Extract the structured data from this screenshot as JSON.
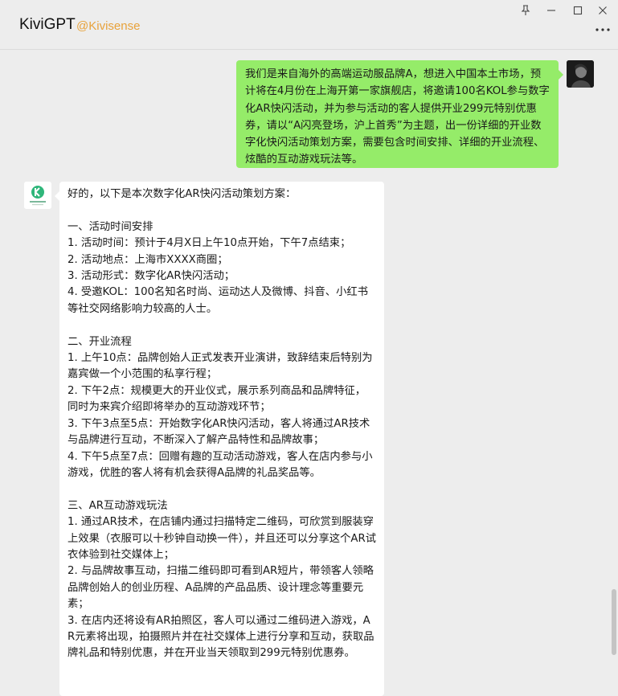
{
  "header": {
    "title": "KiviGPT",
    "handle": "@Kivisense"
  },
  "window_controls": {
    "pin_icon": "pin-icon",
    "minimize_icon": "minimize-icon",
    "maximize_icon": "maximize-icon",
    "close_icon": "close-icon",
    "more_icon": "more-icon"
  },
  "messages": {
    "user": {
      "text": "我们是来自海外的高端运动服品牌A，想进入中国本土市场，预计将在4月份在上海开第一家旗舰店，将邀请100名KOL参与数字化AR快闪活动，并为参与活动的客人提供开业299元特别优惠券，请以“A闪亮登场，沪上首秀”为主题，出一份详细的开业数字化快闪活动策划方案，需要包含时间安排、详细的开业流程、炫酷的互动游戏玩法等。"
    },
    "bot": {
      "text": "好的，以下是本次数字化AR快闪活动策划方案：\n\n一、活动时间安排\n1. 活动时间：预计于4月X日上午10点开始，下午7点结束；\n2. 活动地点：上海市XXXX商圈；\n3. 活动形式：数字化AR快闪活动；\n4. 受邀KOL：100名知名时尚、运动达人及微博、抖音、小红书等社交网络影响力较高的人士。\n\n二、开业流程\n1. 上午10点：品牌创始人正式发表开业演讲，致辞结束后特别为嘉宾做一个小范围的私享行程；\n2. 下午2点：规模更大的开业仪式，展示系列商品和品牌特征，同时为来宾介绍即将举办的互动游戏环节；\n3. 下午3点至5点：开始数字化AR快闪活动，客人将通过AR技术与品牌进行互动，不断深入了解产品特性和品牌故事；\n4. 下午5点至7点：回赠有趣的互动活动游戏，客人在店内参与小游戏，优胜的客人将有机会获得A品牌的礼品奖品等。\n\n三、AR互动游戏玩法\n1. 通过AR技术，在店铺内通过扫描特定二维码，可欣赏到服装穿上效果（衣服可以十秒钟自动换一件），并且还可以分享这个AR试衣体验到社交媒体上；\n2. 与品牌故事互动，扫描二维码即可看到AR短片，带领客人领略品牌创始人的创业历程、A品牌的产品品质、设计理念等重要元素；\n3. 在店内还将设有AR拍照区，客人可以通过二维码进入游戏，AR元素将出现，拍摄照片并在社交媒体上进行分享和互动，获取品牌礼品和特别优惠，并在开业当天领取到299元特别优惠券。"
    }
  },
  "colors": {
    "background": "#ededed",
    "user_bubble": "#95ec69",
    "bot_bubble": "#ffffff",
    "handle": "#e8a23a",
    "brand_green": "#2fb67a"
  }
}
